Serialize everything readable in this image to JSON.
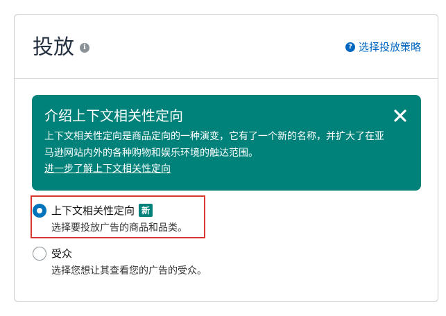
{
  "section": {
    "title": "投放",
    "strategy_link": "选择投放策略"
  },
  "banner": {
    "title": "介绍上下文相关性定向",
    "body": "上下文相关性定向是商品定向的一种演变，它有了一个新的名称，并扩大了在亚马逊网站内外的各种购物和娱乐环境的触达范围。",
    "link": "进一步了解上下文相关性定向",
    "background": "#00827b"
  },
  "options": [
    {
      "label": "上下文相关性定向",
      "badge": "新",
      "description": "选择要投放广告的商品和品类。",
      "selected": true
    },
    {
      "label": "受众",
      "description": "选择您想让其查看您的广告的受众。",
      "selected": false
    }
  ],
  "icons": {
    "info": "info-icon",
    "help": "help-icon",
    "close": "close-icon"
  },
  "colors": {
    "link": "#0066c0",
    "radio_selected": "#0073bb",
    "highlight": "#d9372c"
  }
}
